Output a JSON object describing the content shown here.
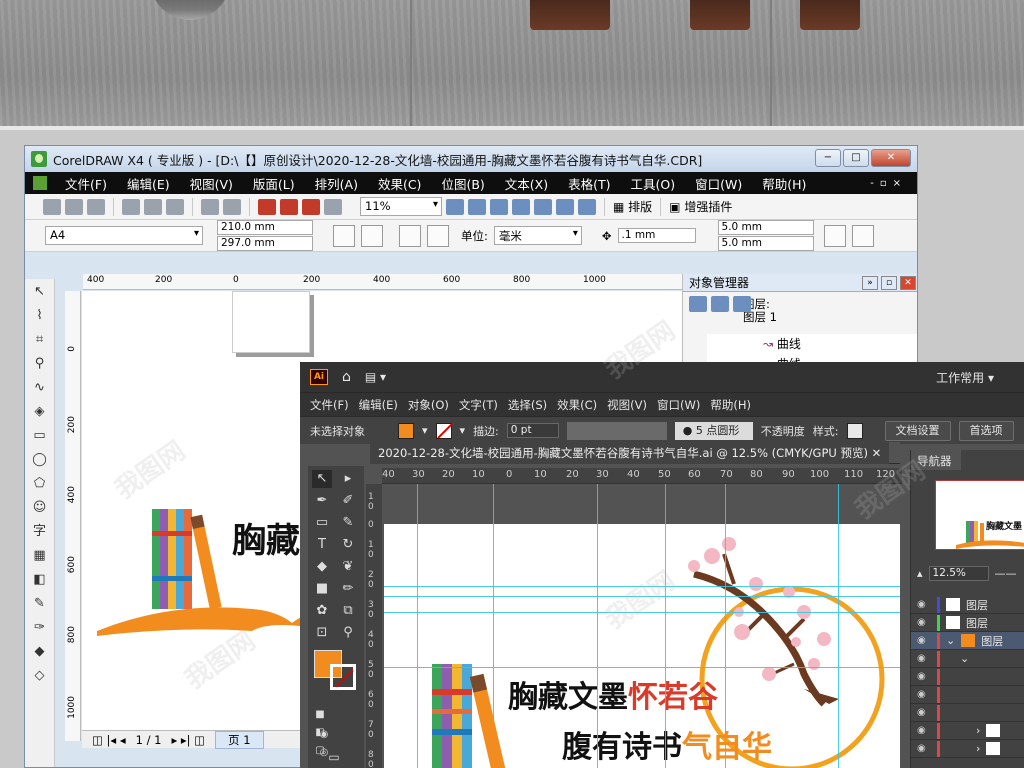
{
  "corel": {
    "title": "CorelDRAW X4 ( 专业版 ) - [D:\\【】原创设计\\2020-12-28-文化墙-校园通用-胸藏文墨怀若谷腹有诗书气自华.CDR]",
    "menu": [
      "文件(F)",
      "编辑(E)",
      "视图(V)",
      "版面(L)",
      "排列(A)",
      "效果(C)",
      "位图(B)",
      "文本(X)",
      "表格(T)",
      "工具(O)",
      "窗口(W)",
      "帮助(H)"
    ],
    "zoom": "11%",
    "arrange_label": "排版",
    "plugin_label": "增强插件",
    "page_size": "A4",
    "width": "210.0 mm",
    "height": "297.0 mm",
    "unit_label": "单位:",
    "unit": "毫米",
    "nudge": ".1 mm",
    "dup_x": "5.0 mm",
    "dup_y": "5.0 mm",
    "ruler_h": [
      "400",
      "200",
      "0",
      "200",
      "400",
      "600",
      "800",
      "1000"
    ],
    "ruler_v": [
      "0",
      "200",
      "400",
      "600",
      "800",
      "1000"
    ],
    "status_page": "1 / 1",
    "status_tab": "页 1",
    "obj_mgr": {
      "title": "对象管理器",
      "layer_label": "图层:",
      "layer_name": "图层 1",
      "items": [
        "曲线",
        "曲线"
      ]
    },
    "tools_text": "字"
  },
  "ai": {
    "logo": "Ai",
    "workspace": "工作常用",
    "menu": [
      "文件(F)",
      "编辑(E)",
      "对象(O)",
      "文字(T)",
      "选择(S)",
      "效果(C)",
      "视图(V)",
      "窗口(W)",
      "帮助(H)"
    ],
    "no_selection": "未选择对象",
    "stroke_label": "描边:",
    "stroke_value": "0 pt",
    "brush": "5 点圆形",
    "opacity_label": "不透明度",
    "style_label": "样式:",
    "doc_settings": "文档设置",
    "prefs": "首选项",
    "tab_title": "2020-12-28-文化墙-校园通用-胸藏文墨怀若谷腹有诗书气自华.ai @ 12.5% (CMYK/GPU 预览)",
    "ruler_h": [
      "40",
      "30",
      "20",
      "10",
      "0",
      "10",
      "20",
      "30",
      "40",
      "50",
      "60",
      "70",
      "80",
      "90",
      "100",
      "110",
      "120"
    ],
    "ruler_v": [
      "1\n0",
      "0",
      "1\n0",
      "2\n0",
      "3\n0",
      "4\n0",
      "5\n0",
      "6\n0",
      "7\n0",
      "8\n0"
    ],
    "navigator": "导航器",
    "nav_zoom": "12.5%",
    "layer_label": "图层"
  },
  "artwork": {
    "line1_black": "胸藏文墨",
    "line1_red": "怀若谷",
    "line2_black": "腹有诗书",
    "line2_orange": "气自华",
    "corel_preview": "胸藏"
  },
  "watermark": "我图网",
  "colors": {
    "orange": "#f28c1e",
    "red": "#d93a2a",
    "ai_dark": "#323232",
    "corel_menu": "#0e0e0e",
    "guide": "#36c6e0"
  }
}
